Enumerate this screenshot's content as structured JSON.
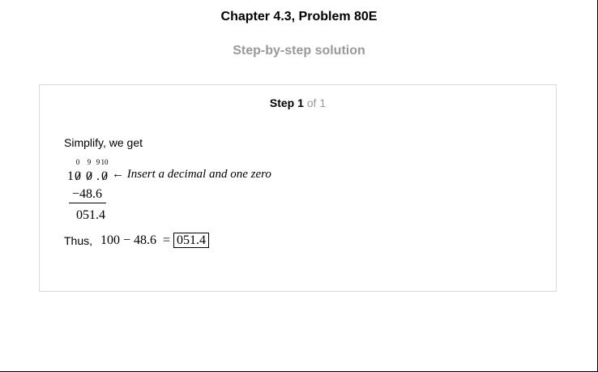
{
  "header": {
    "title": "Chapter 4.3, Problem 80E",
    "subtitle": "Step-by-step solution"
  },
  "step": {
    "label": "Step 1",
    "of_text": "of 1",
    "intro": "Simplify, we get",
    "subtraction": {
      "borrow_marks": [
        "0",
        "9",
        "9",
        "10"
      ],
      "top_digits": [
        "1",
        "0",
        "0",
        ".",
        "0"
      ],
      "note_arrow": "←",
      "note_text": "Insert a decimal and one zero",
      "subtrahend": "−48.6",
      "result": "051.4"
    },
    "conclusion": {
      "label": "Thus,",
      "expression": "100 − 48.6  =",
      "answer": "051.4"
    }
  }
}
